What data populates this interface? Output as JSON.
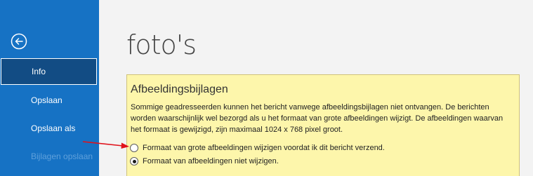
{
  "sidebar": {
    "back_icon": "back-arrow-icon",
    "items": [
      {
        "label": "Info",
        "selected": true,
        "enabled": true
      },
      {
        "label": "Opslaan",
        "selected": false,
        "enabled": true
      },
      {
        "label": "Opslaan als",
        "selected": false,
        "enabled": true
      },
      {
        "label": "Bijlagen opslaan",
        "selected": false,
        "enabled": false
      }
    ],
    "colors": {
      "background": "#1672c4",
      "selected": "#124c84",
      "disabled_text": "#5fa0db"
    }
  },
  "main": {
    "title": "foto's",
    "panel": {
      "heading": "Afbeeldingsbijlagen",
      "description": "Sommige geadresseerden kunnen het bericht vanwege afbeeldingsbijlagen niet ontvangen. De berichten worden waarschijnlijk wel bezorgd als u het formaat van grote afbeeldingen wijzigt. De afbeeldingen waarvan het formaat is gewijzigd, zijn maximaal 1024 x 768 pixel groot.",
      "options": [
        {
          "label": "Formaat van grote afbeeldingen wijzigen voordat ik dit bericht verzend.",
          "checked": false
        },
        {
          "label": "Formaat van afbeeldingen niet wijzigen.",
          "checked": true
        }
      ],
      "background": "#fdf6ab"
    },
    "annotation": {
      "type": "arrow",
      "color": "#e0121b",
      "points_to": "option-resize-images"
    }
  }
}
